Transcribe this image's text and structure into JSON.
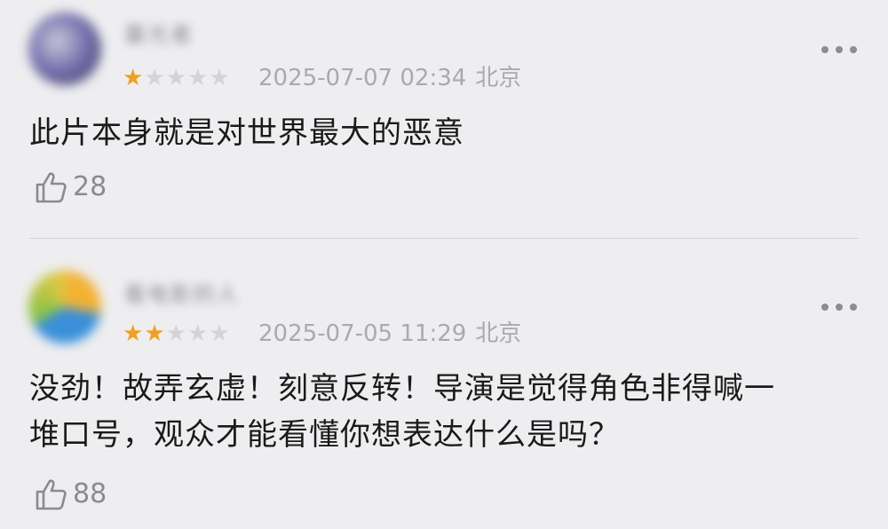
{
  "comments": [
    {
      "username": "暮光者",
      "rating": 1,
      "rating_max": 5,
      "date": "2025-07-07 02:34",
      "location": "北京",
      "text": "此片本身就是对世界最大的恶意",
      "likes": "28",
      "avatar_colors": [
        "#4a4a78",
        "#7a74b0",
        "#c8c8d8"
      ]
    },
    {
      "username": "看电影的人",
      "rating": 2,
      "rating_max": 5,
      "date": "2025-07-05 11:29",
      "location": "北京",
      "text_line1": "没劲！故弄玄虚！刻意反转！导演是觉得角色非得喊一",
      "text_line2": "堆口号，观众才能看懂你想表达什么是吗？",
      "likes": "88",
      "avatar_colors": [
        "#f2b233",
        "#3a8fd8",
        "#7fc24a"
      ]
    }
  ],
  "colors": {
    "star_on": "#f0a020",
    "star_off": "#d4d4d8",
    "meta_text": "#a9a9b0",
    "body_text": "#1a1a1a",
    "background": "#eeeef0"
  },
  "icons": {
    "more": "more-horizontal-icon",
    "like": "thumbs-up-icon",
    "star": "star-icon"
  }
}
